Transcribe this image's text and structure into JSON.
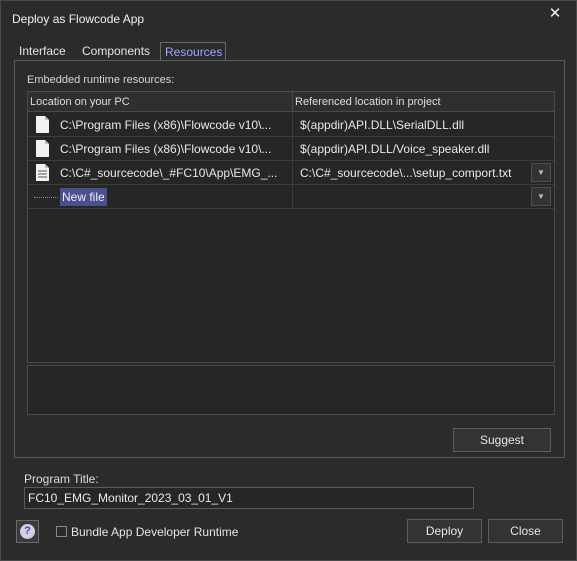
{
  "window": {
    "title": "Deploy as Flowcode App"
  },
  "tabs": [
    {
      "label": "Interface"
    },
    {
      "label": "Components"
    },
    {
      "label": "Resources"
    }
  ],
  "resources": {
    "section_label": "Embedded runtime resources:",
    "columns": [
      "Location on your PC",
      "Referenced location in project"
    ],
    "rows": [
      {
        "pc": "C:\\Program Files (x86)\\Flowcode v10\\...",
        "project": "$(appdir)API.DLL\\SerialDLL.dll",
        "icon": "file-icon",
        "dropdown": false
      },
      {
        "pc": "C:\\Program Files (x86)\\Flowcode v10\\...",
        "project": "$(appdir)API.DLL/Voice_speaker.dll",
        "icon": "file-icon",
        "dropdown": false
      },
      {
        "pc": "C:\\C#_sourcecode\\_#FC10\\App\\EMG_...",
        "project": "C:\\C#_sourcecode\\...\\setup_comport.txt",
        "icon": "text-file-icon",
        "dropdown": true
      }
    ],
    "new_file_label": "New file"
  },
  "buttons": {
    "suggest": "Suggest",
    "deploy": "Deploy",
    "close": "Close"
  },
  "program": {
    "label": "Program Title:",
    "value": "FC10_EMG_Monitor_2023_03_01_V1"
  },
  "bundle": {
    "label": "Bundle App Developer Runtime",
    "checked": false
  },
  "help": {
    "glyph": "?"
  },
  "colors": {
    "accent": "#9fa7ff",
    "selection": "#4a4f8f",
    "background": "#2b2b2b"
  }
}
